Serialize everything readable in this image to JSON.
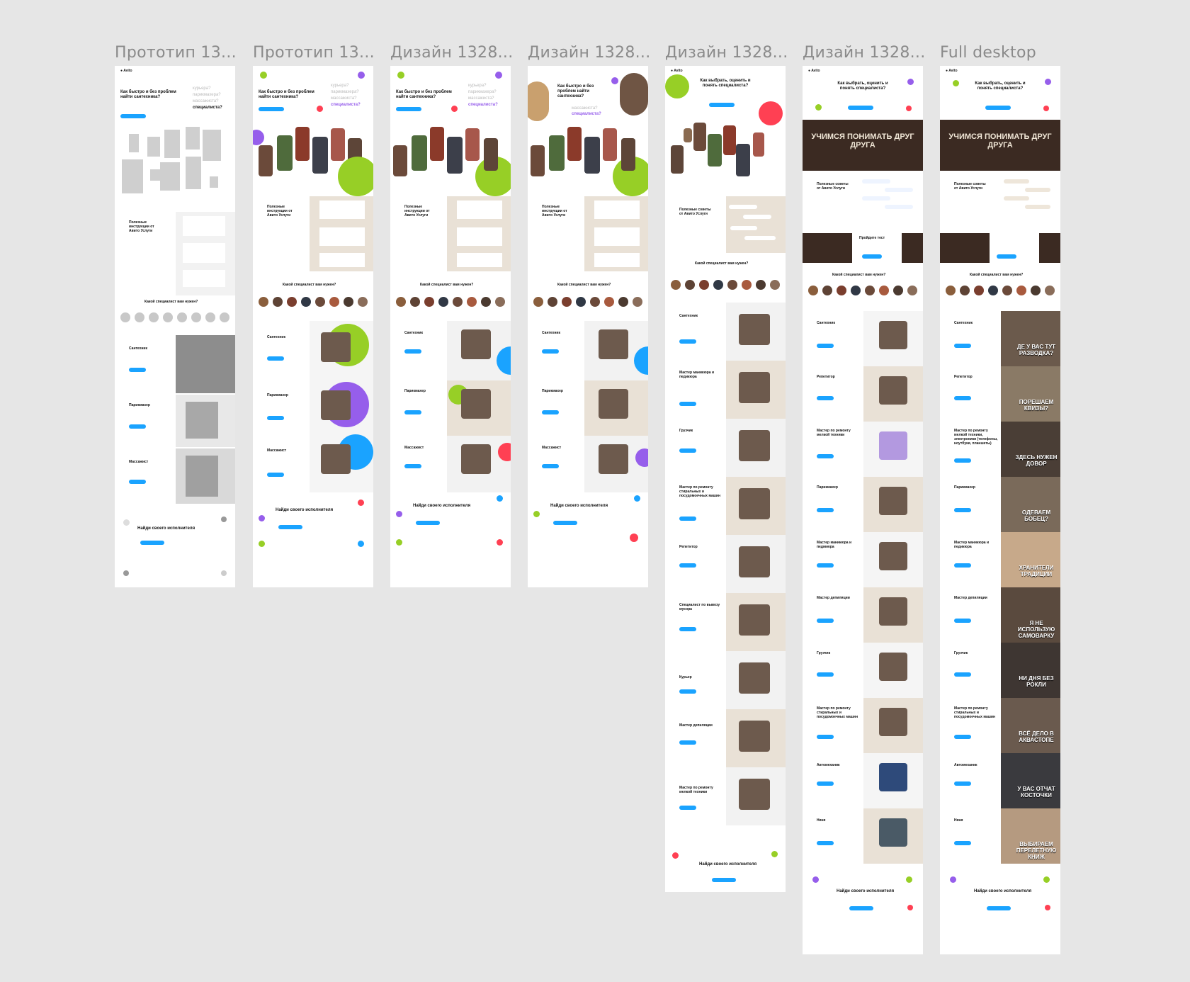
{
  "frames": [
    {
      "title": "Прототип  13...",
      "hero": "Как быстро и без проблем найти сантехника?",
      "words": [
        "курьера?",
        "парикмахера?",
        "массажиста?",
        "специалиста?"
      ],
      "section_tips": "Полезные инструкции от Авито Услуги",
      "section_who": "Какой специалист вам нужен?",
      "cards": [
        "Сантехник",
        "Парикмахер",
        "Массажист"
      ],
      "footer": "Найди своего исполнителя"
    },
    {
      "title": "Прототип  13...",
      "hero": "Как быстро и без проблем найти сантехника?",
      "words": [
        "курьера?",
        "парикмахера?",
        "массажиста?",
        "специалиста?"
      ],
      "section_tips": "Полезные инструкции от Авито Услуги",
      "section_who": "Какой специалист вам нужен?",
      "cards": [
        "Сантехник",
        "Парикмахер",
        "Массажист"
      ],
      "footer": "Найди своего исполнителя"
    },
    {
      "title": "Дизайн  1328...",
      "hero": "Как быстро и без проблем найти сантехника?",
      "words": [
        "курьера?",
        "парикмахера?",
        "массажиста?",
        "специалиста?"
      ],
      "section_tips": "Полезные инструкции от Авито Услуги",
      "section_who": "Какой специалист вам нужен?",
      "cards": [
        "Сантехник",
        "Парикмахер",
        "Массажист"
      ],
      "footer": "Найди своего исполнителя"
    },
    {
      "title": "Дизайн  1328...",
      "hero": "Как быстро и без проблем найти сантехника?",
      "words": [
        "массажиста?",
        "специалиста?"
      ],
      "section_tips": "Полезные инструкции от Авито Услуги",
      "section_who": "Какой специалист вам нужен?",
      "cards": [
        "Сантехник",
        "Парикмахер",
        "Массажист"
      ],
      "footer": "Найди своего исполнителя"
    },
    {
      "title": "Дизайн  1328...",
      "hero": "Как выбрать, оценить и понять специалиста?",
      "section_tips": "Полезные советы от Авито Услуги",
      "section_who": "Какой специалист вам нужен?",
      "cards": [
        "Сантехник",
        "Мастер маникюра и педикюра",
        "Грузчик",
        "Мастер по ремонту стиральных и посудомоечных машин",
        "Репетитор",
        "Специалист по вывозу мусора",
        "Курьер",
        "Мастер депиляции",
        "Мастер по ремонту мелкой техники"
      ],
      "footer": "Найди своего исполнителя"
    },
    {
      "title": "Дизайн  1328...",
      "hero": "Как выбрать, оценить и понять специалиста?",
      "banner": "УЧИМСЯ ПОНИМАТЬ ДРУГ ДРУГА",
      "section_tips": "Полезные советы от Авито Услуги",
      "test": "Пройдите тест",
      "section_who": "Какой специалист вам нужен?",
      "cards": [
        "Сантехник",
        "Репетитор",
        "Мастер по ремонту мелкой техники",
        "Парикмахер",
        "Мастер маникюра и педикюра",
        "Мастер депиляции",
        "Грузчик",
        "Мастер по ремонту стиральных и посудомоечных машин",
        "Автомеханик",
        "Няня"
      ],
      "footer": "Найди своего исполнителя"
    },
    {
      "title": "Full desktop",
      "hero": "Как выбрать, оценить и понять специалиста?",
      "banner": "УЧИМСЯ ПОНИМАТЬ ДРУГ ДРУГА",
      "section_tips": "Полезные советы от Авито Услуги",
      "section_who": "Какой специалист вам нужен?",
      "cards": [
        "Сантехник",
        "Репетитор",
        "Мастер по ремонту мелкой техники, электроники (телефоны, ноутбуки, планшеты)",
        "Парикмахер",
        "Мастер маникюра и педикюра",
        "Мастер депиляции",
        "Грузчик",
        "Мастер по ремонту стиральных и посудомоечных машин",
        "Автомеханик",
        "Няня"
      ],
      "overlays": [
        "ДЕ У ВАС ТУТ РАЗВОДКА?",
        "ПОРЕШАЕМ КВИЗЫ?",
        "ЗДЕСЬ НУЖЕН ДОВОР",
        "ОДЕВАЕМ БОБЕЦ?",
        "ХРАНИТЕЛИ ТРАДИЦИИ",
        "Я НЕ ИСПОЛЬЗУЮ САМОВАРКУ",
        "НИ ДНЯ БЕЗ РОКЛИ",
        "ВСЁ ДЕЛО В АКВАСТОПЕ",
        "У ВАС ОТЧАТ КОСТОЧКИ",
        "ВЫБИРАЕМ ПЕРЕЛЕТНУЮ КНИЖ"
      ],
      "footer": "Найди своего исполнителя"
    }
  ]
}
